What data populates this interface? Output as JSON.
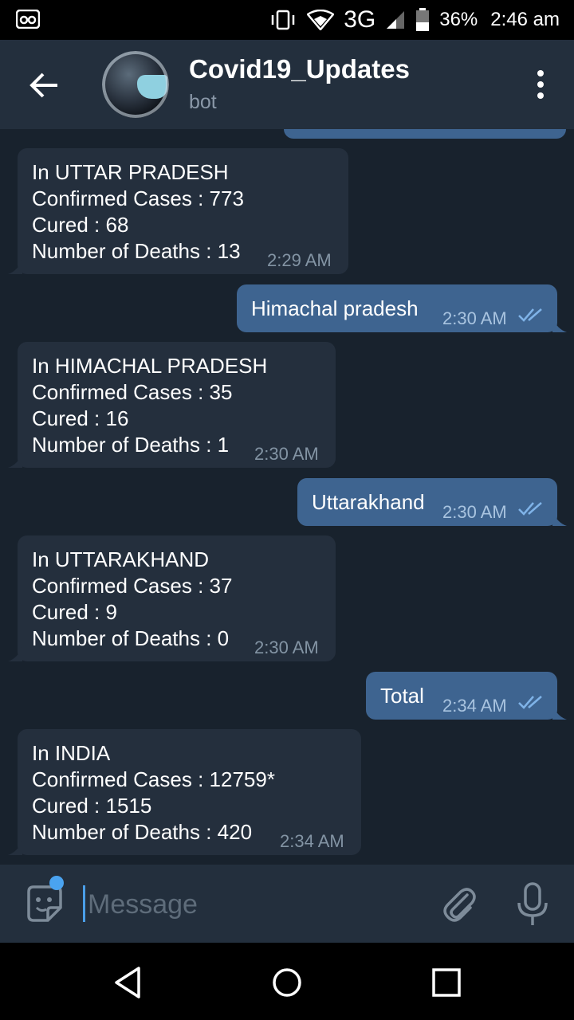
{
  "status_bar": {
    "network": "3G",
    "battery": "36%",
    "time": "2:46 am"
  },
  "header": {
    "title": "Covid19_Updates",
    "subtitle": "bot"
  },
  "messages": [
    {
      "dir": "in",
      "lines": [
        "In UTTAR PRADESH",
        "Confirmed Cases : 773",
        "Cured : 68",
        "Number of Deaths : 13"
      ],
      "time": "2:29 AM"
    },
    {
      "dir": "out",
      "lines": [
        "Himachal pradesh"
      ],
      "time": "2:30 AM"
    },
    {
      "dir": "in",
      "lines": [
        "In HIMACHAL PRADESH",
        "Confirmed Cases : 35",
        "Cured : 16",
        "Number of Deaths : 1"
      ],
      "time": "2:30 AM"
    },
    {
      "dir": "out",
      "lines": [
        "Uttarakhand"
      ],
      "time": "2:30 AM"
    },
    {
      "dir": "in",
      "lines": [
        "In UTTARAKHAND",
        "Confirmed Cases : 37",
        "Cured : 9",
        "Number of Deaths : 0"
      ],
      "time": "2:30 AM"
    },
    {
      "dir": "out",
      "lines": [
        "Total"
      ],
      "time": "2:34 AM"
    },
    {
      "dir": "in",
      "lines": [
        "In INDIA",
        "Confirmed Cases : 12759*",
        "Cured : 1515",
        "Number of Deaths : 420"
      ],
      "time": "2:34 AM"
    }
  ],
  "composer": {
    "placeholder": "Message"
  }
}
